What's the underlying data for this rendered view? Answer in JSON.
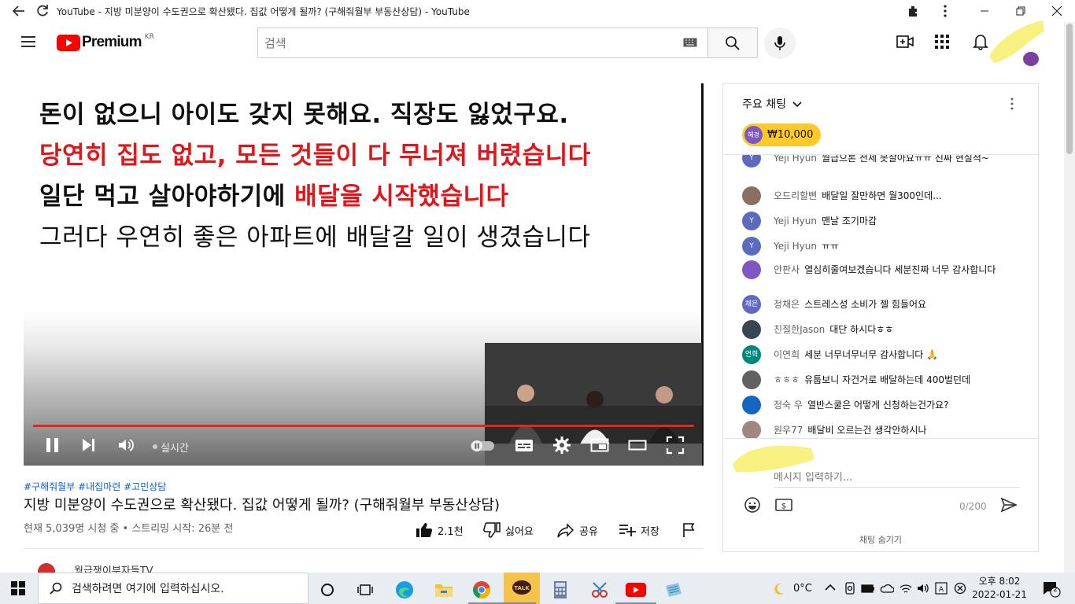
{
  "browser": {
    "window_title": "YouTube - 지방 미분양이 수도권으로 확산됐다. 집값 어떻게 될까? (구해줘월부 부동산상담) - YouTube"
  },
  "header": {
    "logo_text": "Premium",
    "region": "KR",
    "search_placeholder": "검색"
  },
  "video": {
    "subtitle_lines": [
      {
        "text": "돈이 없으니 아이도 갖지 못해요. 직장도 잃었구요."
      },
      {
        "text": "당연히 집도 없고, 모든 것들이 다 무너져 버렸습니다"
      },
      {
        "prefix": "일단 먹고 살아야하기에 ",
        "highlight": "배달을 시작했습니다"
      },
      {
        "text": "그러다 우연히 좋은 아파트에 배달갈 일이 생겼습니다"
      }
    ],
    "live_label": "실시간",
    "progress": 1.0
  },
  "info": {
    "hashtags": "#구해줘월부 #내집마련 #고민상담",
    "title": "지방 미분양이 수도권으로 확산됐다. 집값 어떻게 될까? (구해줘월부 부동산상담)",
    "meta": "현재 5,039명 시청 중 • 스트리밍 시작: 26분 전",
    "like_count": "2.1천",
    "dislike_label": "싫어요",
    "share_label": "공유",
    "save_label": "저장",
    "channel_peek": "월급쟁이부자들TV"
  },
  "chat": {
    "header_label": "주요 채팅",
    "donation": {
      "avatar_text": "혜경",
      "amount": "₩10,000"
    },
    "messages": [
      {
        "name": "Yeji Hyun",
        "text": "월급으론 전세 못살아요ㅠㅠ 진짜 현실적~",
        "avatar": "Y",
        "color": "#5c6bc0"
      },
      {
        "name": "오드리할삔",
        "text": "배달일 잘만하면 월300인데...",
        "avatar": "",
        "color": "#8d6e63"
      },
      {
        "name": "Yeji Hyun",
        "text": "맨날 조기마감",
        "avatar": "Y",
        "color": "#5c6bc0"
      },
      {
        "name": "Yeji Hyun",
        "text": "ㅠㅠ",
        "avatar": "Y",
        "color": "#5c6bc0"
      },
      {
        "name": "안판사",
        "text": "열심히줄여보겠습니다 세분진짜 너무 감사합니다",
        "avatar": "",
        "color": "#7e57c2"
      },
      {
        "name": "정채은",
        "text": "스트레스성 소비가 젤 힘들어요",
        "avatar": "채은",
        "color": "#5c6bc0"
      },
      {
        "name": "친절한Jason",
        "text": "대단 하시다ㅎㅎ",
        "avatar": "",
        "color": "#37474f"
      },
      {
        "name": "이연희",
        "text": "세분 너무너무너무 감사합니다 🙏",
        "avatar": "연희",
        "color": "#00897b"
      },
      {
        "name": "ㅎㅎㅎ",
        "text": "유툽보니 자건거로 배달하는데 400벌던데",
        "avatar": "",
        "color": "#616161"
      },
      {
        "name": "정숙 우",
        "text": "열반스쿨은 어떻게 신청하는건가요?",
        "avatar": "",
        "color": "#1565c0"
      },
      {
        "name": "원우77",
        "text": "배달비 오르는건 생각안하시나",
        "avatar": "",
        "color": "#a1887f"
      }
    ],
    "input_placeholder": "메시지 입력하기...",
    "char_count": "0/200",
    "hide_label": "채팅 숨기기"
  },
  "taskbar": {
    "search_placeholder": "검색하려면 여기에 입력하십시오.",
    "temperature": "0°C",
    "time": "오후 8:02",
    "date": "2022-01-21",
    "notification_count": "2"
  },
  "colors": {
    "youtube_red": "#ff0000",
    "subtitle_red": "#e0161b",
    "donation_yellow": "#ffca28",
    "link_blue": "#065fd4"
  }
}
